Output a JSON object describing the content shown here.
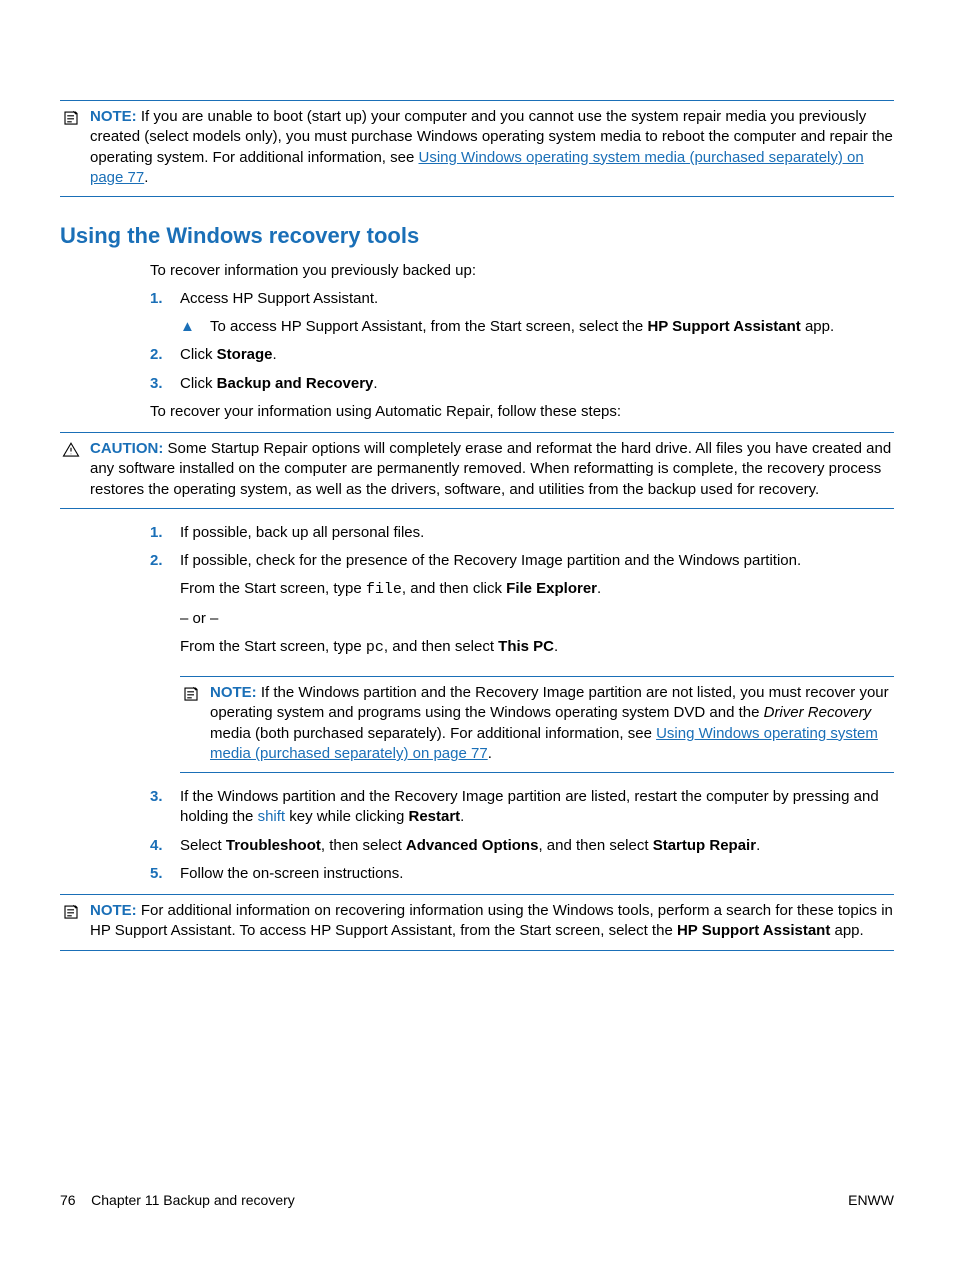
{
  "note1": {
    "label": "NOTE:",
    "text_a": "If you are unable to boot (start up) your computer and you cannot use the system repair media you previously created (select models only), you must purchase Windows operating system media to reboot the computer and repair the operating system. For additional information, see ",
    "link": "Using Windows operating system media (purchased separately) on page 77",
    "text_b": "."
  },
  "heading": "Using the Windows recovery tools",
  "intro1": "To recover information you previously backed up:",
  "steps1": [
    {
      "num": "1.",
      "text": "Access HP Support Assistant."
    },
    {
      "num": "2.",
      "pre": "Click ",
      "bold": "Storage",
      "post": "."
    },
    {
      "num": "3.",
      "pre": "Click ",
      "bold": "Backup and Recovery",
      "post": "."
    }
  ],
  "sub1": {
    "pre": "To access HP Support Assistant, from the Start screen, select the ",
    "bold": "HP Support Assistant",
    "post": " app."
  },
  "intro2": "To recover your information using Automatic Repair, follow these steps:",
  "caution": {
    "label": "CAUTION:",
    "text": "Some Startup Repair options will completely erase and reformat the hard drive. All files you have created and any software installed on the computer are permanently removed. When reformatting is complete, the recovery process restores the operating system, as well as the drivers, software, and utilities from the backup used for recovery."
  },
  "steps2": {
    "s1": {
      "num": "1.",
      "text": "If possible, back up all personal files."
    },
    "s2": {
      "num": "2.",
      "text": "If possible, check for the presence of the Recovery Image partition and the Windows partition."
    },
    "s2a": {
      "pre": "From the Start screen, type ",
      "mono": "file",
      "mid": ", and then click ",
      "bold": "File Explorer",
      "post": "."
    },
    "s2or": "– or –",
    "s2b": {
      "pre": "From the Start screen, type ",
      "mono": "pc",
      "mid": ", and then select ",
      "bold": "This PC",
      "post": "."
    },
    "s3": {
      "num": "3.",
      "pre": "If the Windows partition and the Recovery Image partition are listed, restart the computer by pressing and holding the ",
      "shift": "shift",
      "mid": " key while clicking ",
      "bold": "Restart",
      "post": "."
    },
    "s4": {
      "num": "4.",
      "pre": "Select ",
      "b1": "Troubleshoot",
      "m1": ", then select ",
      "b2": "Advanced Options",
      "m2": ", and then select ",
      "b3": "Startup Repair",
      "post": "."
    },
    "s5": {
      "num": "5.",
      "text": "Follow the on-screen instructions."
    }
  },
  "note2": {
    "label": "NOTE:",
    "pre": "If the Windows partition and the Recovery Image partition are not listed, you must recover your operating system and programs using the Windows operating system DVD and the ",
    "italic": "Driver Recovery",
    "mid": " media (both purchased separately). For additional information, see ",
    "link": "Using Windows operating system media (purchased separately) on page 77",
    "post": "."
  },
  "note3": {
    "label": "NOTE:",
    "pre": "For additional information on recovering information using the Windows tools, perform a search for these topics in HP Support Assistant. To access HP Support Assistant, from the Start screen, select the ",
    "bold": "HP Support Assistant",
    "post": " app."
  },
  "footer": {
    "page": "76",
    "chapter": "Chapter 11   Backup and recovery",
    "right": "ENWW"
  }
}
